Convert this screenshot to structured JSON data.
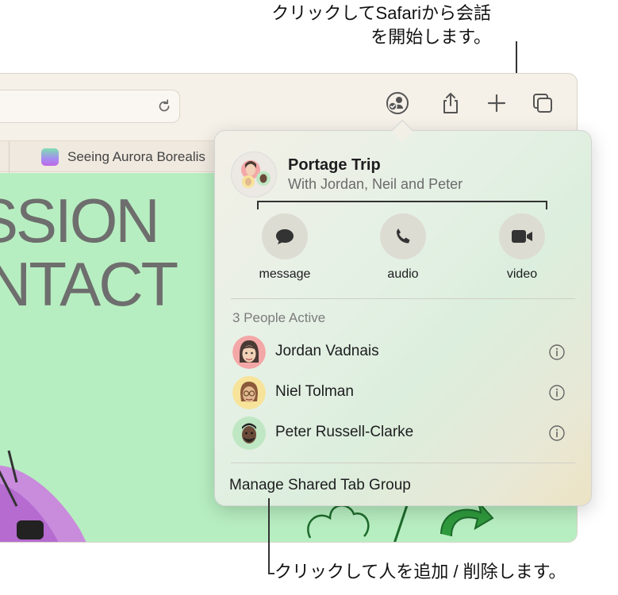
{
  "callouts": {
    "top": "クリックしてSafariから会話\nを開始します。",
    "bottom": "クリックして人を追加 / 削除します。"
  },
  "browser": {
    "tab": {
      "title": "Seeing Aurora Borealis"
    },
    "page_hero": {
      "line1": "SSION",
      "line2": "NTACT"
    }
  },
  "toolbar_icons": [
    "reload-icon",
    "collaboration-icon",
    "share-icon",
    "new-tab-plus-icon",
    "tab-overview-icon"
  ],
  "popover": {
    "group_title": "Portage Trip",
    "group_subtitle": "With Jordan, Neil and Peter",
    "actions": [
      {
        "label": "message",
        "icon": "message-bubble-icon"
      },
      {
        "label": "audio",
        "icon": "phone-icon"
      },
      {
        "label": "video",
        "icon": "video-camera-icon"
      }
    ],
    "people_header": "3 People Active",
    "people": [
      {
        "name": "Jordan Vadnais",
        "avatar_color": "#f4a7a7"
      },
      {
        "name": "Niel Tolman",
        "avatar_color": "#f7e39a"
      },
      {
        "name": "Peter Russell-Clarke",
        "avatar_color": "#bfe7c3"
      }
    ],
    "manage_label": "Manage Shared Tab Group"
  }
}
